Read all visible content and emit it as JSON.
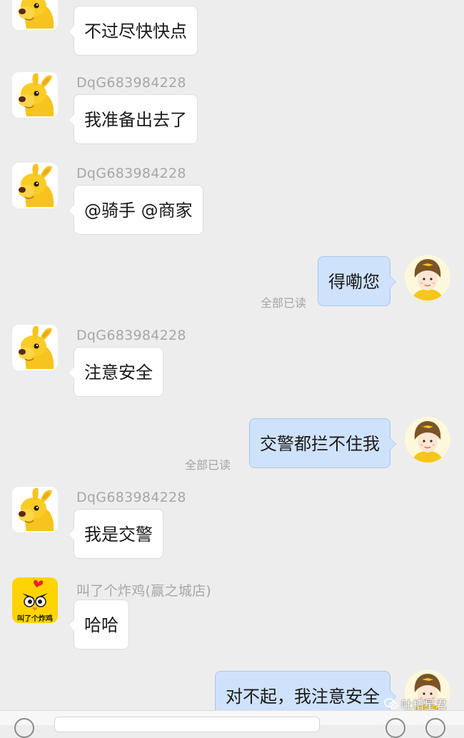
{
  "colors": {
    "background": "#ededed",
    "bubble_incoming": "#ffffff",
    "bubble_outgoing": "#cfe2fb",
    "sender_name": "#a7a7a7",
    "read_status": "#a5a5a5"
  },
  "messages": [
    {
      "side": "left",
      "avatar": "kangaroo-avatar-icon",
      "sender": "",
      "text": "不过尽快快点"
    },
    {
      "side": "left",
      "avatar": "kangaroo-avatar-icon",
      "sender": "DqG683984228",
      "text": "我准备出去了"
    },
    {
      "side": "left",
      "avatar": "kangaroo-avatar-icon",
      "sender": "DqG683984228",
      "text": "@骑手 @商家"
    },
    {
      "side": "right",
      "avatar": "rider-avatar-icon",
      "text": "得嘞您",
      "status": "全部已读"
    },
    {
      "side": "left",
      "avatar": "kangaroo-avatar-icon",
      "sender": "DqG683984228",
      "text": "注意安全"
    },
    {
      "side": "right",
      "avatar": "rider-avatar-icon",
      "text": "交警都拦不住我",
      "status": "全部已读"
    },
    {
      "side": "left",
      "avatar": "kangaroo-avatar-icon",
      "sender": "DqG683984228",
      "text": "我是交警"
    },
    {
      "side": "left",
      "avatar": "fried-chicken-logo-icon",
      "sender": "叫了个炸鸡(赢之城店)",
      "text": "哈哈"
    },
    {
      "side": "right",
      "avatar": "rider-avatar-icon",
      "text": "对不起，我注意安全"
    }
  ],
  "logo_text": "叫了个炸鸡",
  "watermark": "吐槽星君"
}
